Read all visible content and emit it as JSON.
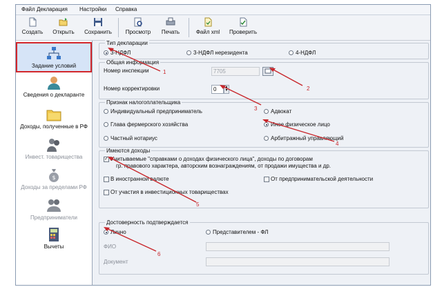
{
  "menu": [
    "Файл",
    "Декларация",
    "Настройки",
    "Справка"
  ],
  "toolbar": [
    "Создать",
    "Открыть",
    "Сохранить",
    "Просмотр",
    "Печать",
    "Файл xml",
    "Проверить"
  ],
  "sidebar": [
    {
      "label": "Задание условий",
      "icon": "tree-structure-icon"
    },
    {
      "label": "Сведения о декларанте",
      "icon": "person-icon"
    },
    {
      "label": "Доходы, полученные в РФ",
      "icon": "folders-icon"
    },
    {
      "label": "Инвест. товарищества",
      "icon": "people-icon"
    },
    {
      "label": "Доходы за пределами РФ",
      "icon": "money-bag-icon"
    },
    {
      "label": "Предприниматели",
      "icon": "handshake-icon"
    },
    {
      "label": "Вычеты",
      "icon": "calculator-icon"
    }
  ],
  "decl_type": {
    "title": "Тип декларации",
    "options": [
      "3-НДФЛ",
      "3-НДФЛ нерезидента",
      "4-НДФЛ"
    ],
    "selected": 0
  },
  "general": {
    "title": "Общая информация",
    "inspection_label": "Номер инспекции",
    "inspection_value": "7705",
    "correction_label": "Номер корректировки",
    "correction_value": "0"
  },
  "taxpayer": {
    "title": "Признак налогоплательщика",
    "options": [
      "Индивидуальный предприниматель",
      "Адвокат",
      "Глава фермерского хозяйства",
      "Иное физическое лицо",
      "Частный нотариус",
      "Арбитражный управляющий"
    ],
    "selected": 3
  },
  "income": {
    "title": "Имеются доходы",
    "line1": "Учитываемые \"справками о доходах физического лица\", доходы по договорам",
    "line2": "гр. правового характера, авторским вознаграждениям, от продажи имущества и др.",
    "foreign": "В иностранной валюте",
    "business": "От предпринимательской деятельности",
    "partnerships": "От участия в инвестиционных товариществах"
  },
  "confirm": {
    "title": "Достоверность подтверждается",
    "personal": "Лично",
    "representative": "Представителем - ФЛ",
    "fio_label": "ФИО",
    "doc_label": "Документ"
  },
  "annotations": [
    "1",
    "2",
    "3",
    "4",
    "5",
    "6"
  ],
  "colors": {
    "annotation": "#c8262b",
    "selection_bg": "#d6e4f7"
  }
}
